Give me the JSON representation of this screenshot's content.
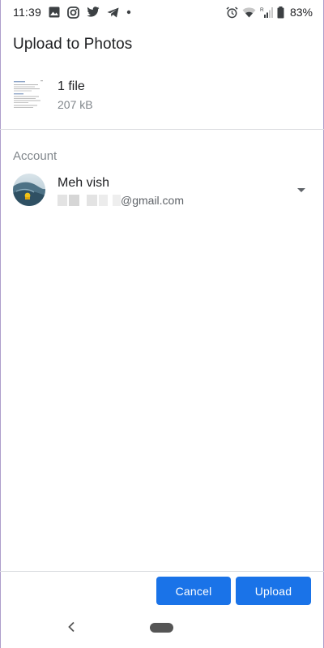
{
  "status_bar": {
    "time": "11:39",
    "battery": "83%",
    "left_icons": [
      "image-icon",
      "instagram-icon",
      "twitter-icon",
      "telegram-icon",
      "dot-icon"
    ],
    "right_icons": [
      "alarm-icon",
      "wifi-icon",
      "signal-icon",
      "battery-icon"
    ],
    "signal_badge": "R"
  },
  "dialog": {
    "title": "Upload to Photos",
    "file": {
      "count": "1 file",
      "size": "207 kB"
    },
    "account": {
      "heading": "Account",
      "name": "Meh vish",
      "email_suffix": "@gmail.com"
    },
    "buttons": {
      "cancel": "Cancel",
      "upload": "Upload"
    }
  },
  "colors": {
    "accent": "#1a73e8",
    "divider": "#dadce0",
    "secondary_text": "#80868b"
  }
}
